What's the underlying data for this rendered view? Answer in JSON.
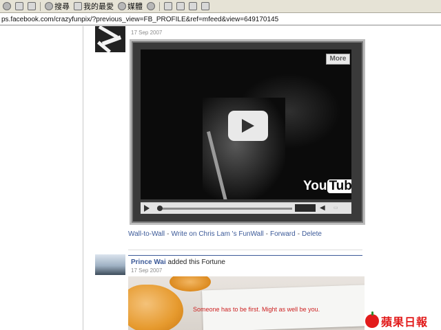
{
  "toolbar": {
    "search_label": "搜尋",
    "favorites_label": "我的最愛",
    "media_label": "媒體"
  },
  "address_bar": {
    "url": "ps.facebook.com/crazyfunpix/?previous_view=FB_PROFILE&ref=mfeed&view=649170145"
  },
  "posts": [
    {
      "date": "17 Sep 2007",
      "video": {
        "more_label": "More",
        "logo_you": "You",
        "logo_tube": "Tube"
      },
      "actions": [
        "Wall-to-Wall",
        "Write on Chris Lam 's FunWall",
        "Forward",
        "Delete"
      ]
    },
    {
      "author": "Prince Wai",
      "action_text": "added this Fortune",
      "date": "17 Sep 2007",
      "fortune_text": "Someone has to be first. Might as well be you."
    }
  ],
  "watermark": {
    "text": "蘋果日報",
    "color": "#e21b1b"
  },
  "colors": {
    "link": "#3b5998",
    "fortune_text": "#cc1f1f"
  }
}
